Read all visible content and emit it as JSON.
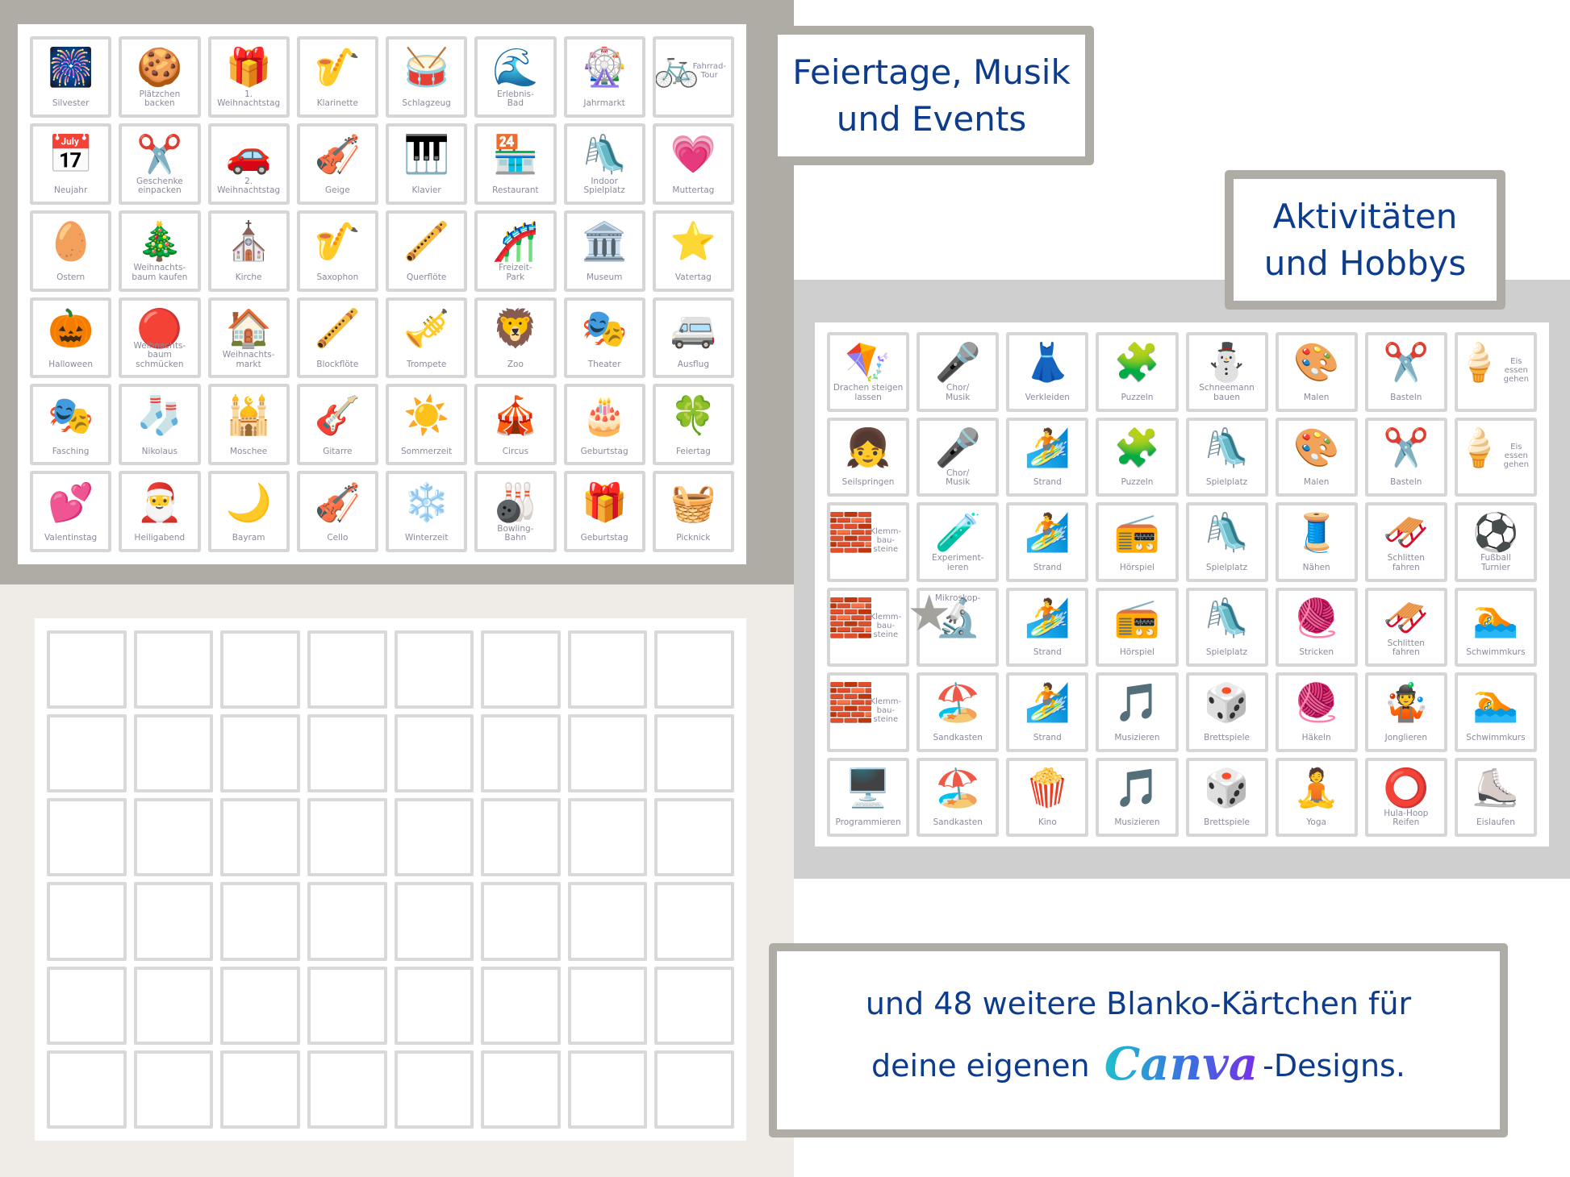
{
  "colors": {
    "panel_gray": "#afaca5",
    "panel_light_gray": "#cfcfcf",
    "beige": "#efebe7",
    "title_text": "#0e3c8c",
    "card_border": "#d6d6d6",
    "card_label": "#8a8b9c",
    "canva_gradient": [
      "#1ec3cf",
      "#3b6fe0",
      "#7d2ae8"
    ]
  },
  "titles": {
    "events": [
      "Feiertage, Musik",
      "und Events"
    ],
    "activities": [
      "Aktivitäten",
      "und Hobbys"
    ],
    "blank": {
      "line1": "und 48 weitere Blanko-Kärtchen für",
      "line2_before": "deine eigenen",
      "brand": "Canva",
      "line2_after": "-Designs."
    }
  },
  "events_cards": [
    {
      "label": "Silvester",
      "icon": "fireworks-icon",
      "glyph": "🎆"
    },
    {
      "label": "Plätzchen\nbacken",
      "icon": "cookie-dough-icon",
      "glyph": "🍪"
    },
    {
      "label": "1.\nWeihnachtstag",
      "icon": "gifts-icon",
      "glyph": "🎁"
    },
    {
      "label": "Klarinette",
      "icon": "clarinet-icon",
      "glyph": "🎷"
    },
    {
      "label": "Schlagzeug",
      "icon": "drums-icon",
      "glyph": "🥁"
    },
    {
      "label": "Erlebnis-\nBad",
      "icon": "water-slide-icon",
      "glyph": "🌊"
    },
    {
      "label": "Jahrmarkt",
      "icon": "ferris-wheel-icon",
      "glyph": "🎡"
    },
    {
      "label": "Fahrrad-\nTour",
      "icon": "tandem-bike-icon",
      "glyph": "🚲",
      "side": true
    },
    {
      "label": "Neujahr",
      "icon": "calendar-icon",
      "glyph": "📅"
    },
    {
      "label": "Geschenke\neinpacken",
      "icon": "wrapping-icon",
      "glyph": "✂️"
    },
    {
      "label": "2.\nWeihnachtstag",
      "icon": "car-gifts-icon",
      "glyph": "🚗"
    },
    {
      "label": "Geige",
      "icon": "violin-icon",
      "glyph": "🎻"
    },
    {
      "label": "Klavier",
      "icon": "piano-icon",
      "glyph": "🎹"
    },
    {
      "label": "Restaurant",
      "icon": "restaurant-icon",
      "glyph": "🏪"
    },
    {
      "label": "Indoor\nSpielplatz",
      "icon": "playground-icon",
      "glyph": "🛝"
    },
    {
      "label": "Muttertag",
      "icon": "best-mom-icon",
      "glyph": "💗"
    },
    {
      "label": "Ostern",
      "icon": "easter-eggs-icon",
      "glyph": "🥚"
    },
    {
      "label": "Weihnachts-\nbaum kaufen",
      "icon": "christmas-tree-icon",
      "glyph": "🎄"
    },
    {
      "label": "Kirche",
      "icon": "church-icon",
      "glyph": "⛪"
    },
    {
      "label": "Saxophon",
      "icon": "saxophone-icon",
      "glyph": "🎷"
    },
    {
      "label": "Querflöte",
      "icon": "flute-icon",
      "glyph": "🪈"
    },
    {
      "label": "Freizeit-\nPark",
      "icon": "roller-coaster-icon",
      "glyph": "🎢"
    },
    {
      "label": "Museum",
      "icon": "museum-icon",
      "glyph": "🏛️"
    },
    {
      "label": "Vatertag",
      "icon": "awesome-dad-icon",
      "glyph": "⭐"
    },
    {
      "label": "Halloween",
      "icon": "pumpkin-icon",
      "glyph": "🎃"
    },
    {
      "label": "Weihnachts-\nbaum\nschmücken",
      "icon": "ornaments-icon",
      "glyph": "🔴"
    },
    {
      "label": "Weihnachts-\nmarkt",
      "icon": "christmas-market-icon",
      "glyph": "🏠"
    },
    {
      "label": "Blockflöte",
      "icon": "recorder-icon",
      "glyph": "🪈"
    },
    {
      "label": "Trompete",
      "icon": "trumpet-icon",
      "glyph": "🎺"
    },
    {
      "label": "Zoo",
      "icon": "zoo-icon",
      "glyph": "🦁"
    },
    {
      "label": "Theater",
      "icon": "curtain-icon",
      "glyph": "🎭"
    },
    {
      "label": "Ausflug",
      "icon": "camper-van-icon",
      "glyph": "🚐"
    },
    {
      "label": "Fasching",
      "icon": "carnival-mask-icon",
      "glyph": "🎭"
    },
    {
      "label": "Nikolaus",
      "icon": "stocking-icon",
      "glyph": "🧦"
    },
    {
      "label": "Moschee",
      "icon": "mosque-icon",
      "glyph": "🕌"
    },
    {
      "label": "Gitarre",
      "icon": "guitar-icon",
      "glyph": "🎸"
    },
    {
      "label": "Sommerzeit",
      "icon": "sun-clock-icon",
      "glyph": "☀️"
    },
    {
      "label": "Circus",
      "icon": "circus-tent-icon",
      "glyph": "🎪"
    },
    {
      "label": "Geburtstag",
      "icon": "cake-icon",
      "glyph": "🎂"
    },
    {
      "label": "Feiertag",
      "icon": "clover-icon",
      "glyph": "🍀"
    },
    {
      "label": "Valentinstag",
      "icon": "love-birds-icon",
      "glyph": "💕"
    },
    {
      "label": "Heiligabend",
      "icon": "santa-sleigh-icon",
      "glyph": "🎅"
    },
    {
      "label": "Bayram",
      "icon": "crescent-moon-icon",
      "glyph": "🌙"
    },
    {
      "label": "Cello",
      "icon": "cello-icon",
      "glyph": "🎻"
    },
    {
      "label": "Winterzeit",
      "icon": "snowflake-clock-icon",
      "glyph": "❄️"
    },
    {
      "label": "Bowling-\nBahn",
      "icon": "bowling-pins-icon",
      "glyph": "🎳"
    },
    {
      "label": "Geburtstag",
      "icon": "gift-box-icon",
      "glyph": "🎁"
    },
    {
      "label": "Picknick",
      "icon": "picnic-basket-icon",
      "glyph": "🧺"
    }
  ],
  "activities_cards": [
    {
      "label": "Drachen steigen\nlassen",
      "icon": "kite-icon",
      "glyph": "🪁"
    },
    {
      "label": "Chor/\nMusik",
      "icon": "microphone-icon",
      "glyph": "🎤"
    },
    {
      "label": "Verkleiden",
      "icon": "dress-up-icon",
      "glyph": "👗"
    },
    {
      "label": "Puzzeln",
      "icon": "puzzle-icon",
      "glyph": "🧩"
    },
    {
      "label": "Schneemann\nbauen",
      "icon": "snowman-icon",
      "glyph": "⛄"
    },
    {
      "label": "Malen",
      "icon": "paint-box-icon",
      "glyph": "🎨"
    },
    {
      "label": "Basteln",
      "icon": "scissors-glue-icon",
      "glyph": "✂️"
    },
    {
      "label": "Eis\nessen\ngehen",
      "icon": "ice-cream-icon",
      "glyph": "🍦",
      "side": true
    },
    {
      "label": "Seilspringen",
      "icon": "jump-rope-icon",
      "glyph": "👧"
    },
    {
      "label": "Chor/\nMusik",
      "icon": "microphone-icon",
      "glyph": "🎤"
    },
    {
      "label": "Strand",
      "icon": "beach-icon",
      "glyph": "🏄"
    },
    {
      "label": "Puzzeln",
      "icon": "puzzle-icon",
      "glyph": "🧩"
    },
    {
      "label": "Spielplatz",
      "icon": "playground-icon",
      "glyph": "🛝"
    },
    {
      "label": "Malen",
      "icon": "paint-box-icon",
      "glyph": "🎨"
    },
    {
      "label": "Basteln",
      "icon": "scissors-glue-icon",
      "glyph": "✂️"
    },
    {
      "label": "Eis\nessen\ngehen",
      "icon": "ice-cream-icon",
      "glyph": "🍦",
      "side": true
    },
    {
      "label": "Klemm-\nbau-\nsteine",
      "icon": "building-blocks-icon",
      "glyph": "🧱",
      "side": true
    },
    {
      "label": "Experiment-\nieren",
      "icon": "experiment-icon",
      "glyph": "🧪"
    },
    {
      "label": "Strand",
      "icon": "beach-icon",
      "glyph": "🏄"
    },
    {
      "label": "Hörspiel",
      "icon": "radio-icon",
      "glyph": "📻"
    },
    {
      "label": "Spielplatz",
      "icon": "playground-icon",
      "glyph": "🛝"
    },
    {
      "label": "Nähen",
      "icon": "sewing-machine-icon",
      "glyph": "🧵"
    },
    {
      "label": "Schlitten\nfahren",
      "icon": "sled-icon",
      "glyph": "🛷"
    },
    {
      "label": "Fußball\nTurnier",
      "icon": "soccer-icon",
      "glyph": "⚽"
    },
    {
      "label": "Klemm-\nbau-\nsteine",
      "icon": "building-blocks-icon",
      "glyph": "🧱",
      "side": true
    },
    {
      "label": "Mikroskop-",
      "icon": "microscope-icon",
      "glyph": "🔬",
      "top_label": true
    },
    {
      "label": "Strand",
      "icon": "beach-icon",
      "glyph": "🏄"
    },
    {
      "label": "Hörspiel",
      "icon": "radio-icon",
      "glyph": "📻"
    },
    {
      "label": "Spielplatz",
      "icon": "playground-icon",
      "glyph": "🛝"
    },
    {
      "label": "Stricken",
      "icon": "knitting-icon",
      "glyph": "🧶"
    },
    {
      "label": "Schlitten\nfahren",
      "icon": "sled-icon",
      "glyph": "🛷"
    },
    {
      "label": "Schwimmkurs",
      "icon": "swimming-pool-icon",
      "glyph": "🏊"
    },
    {
      "label": "Klemm-\nbau-\nsteine",
      "icon": "building-blocks-icon",
      "glyph": "🧱",
      "side": true
    },
    {
      "label": "Sandkasten",
      "icon": "sandbox-icon",
      "glyph": "🏖️"
    },
    {
      "label": "Strand",
      "icon": "beach-icon",
      "glyph": "🏄"
    },
    {
      "label": "Musizieren",
      "icon": "music-notes-icon",
      "glyph": "🎵"
    },
    {
      "label": "Brettspiele",
      "icon": "board-game-icon",
      "glyph": "🎲"
    },
    {
      "label": "Häkeln",
      "icon": "crochet-icon",
      "glyph": "🧶"
    },
    {
      "label": "Jonglieren",
      "icon": "juggling-pins-icon",
      "glyph": "🤹"
    },
    {
      "label": "Schwimmkurs",
      "icon": "swimming-pool-icon",
      "glyph": "🏊"
    },
    {
      "label": "Programmieren",
      "icon": "computer-icon",
      "glyph": "🖥️"
    },
    {
      "label": "Sandkasten",
      "icon": "sandbox-icon",
      "glyph": "🏖️"
    },
    {
      "label": "Kino",
      "icon": "popcorn-icon",
      "glyph": "🍿"
    },
    {
      "label": "Musizieren",
      "icon": "music-notes-icon",
      "glyph": "🎵"
    },
    {
      "label": "Brettspiele",
      "icon": "board-game-icon",
      "glyph": "🎲"
    },
    {
      "label": "Yoga",
      "icon": "yoga-icon",
      "glyph": "🧘"
    },
    {
      "label": "Hula-Hoop\nReifen",
      "icon": "hula-hoop-icon",
      "glyph": "⭕"
    },
    {
      "label": "Eislaufen",
      "icon": "ice-skates-icon",
      "glyph": "⛸️"
    }
  ],
  "blank_cards_count": 48,
  "overlay": {
    "icon": "star-icon",
    "glyph": "★"
  }
}
